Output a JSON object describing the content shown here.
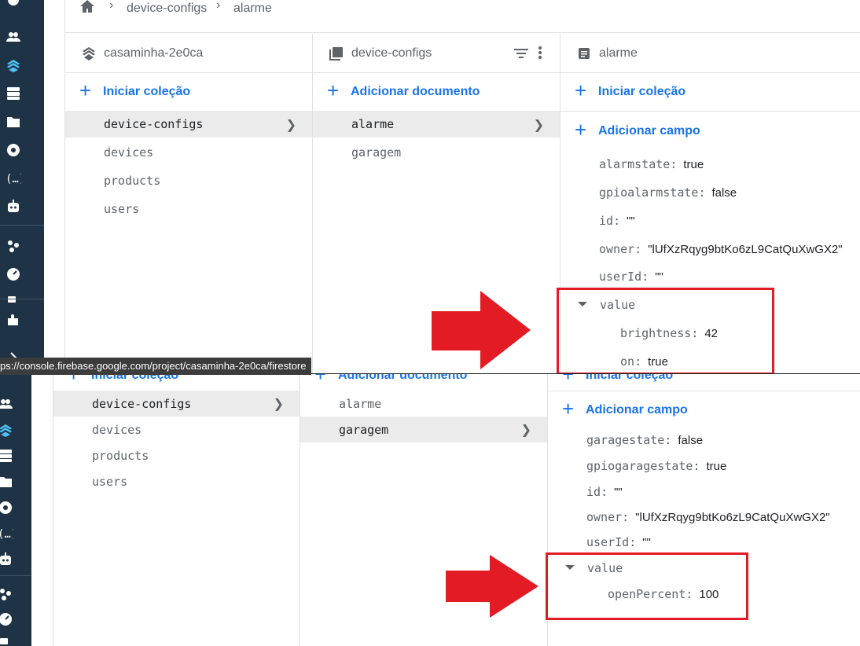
{
  "breadcrumb": {
    "home_icon": "home-icon",
    "items": [
      "device-configs",
      "alarme"
    ]
  },
  "status_url": "ps://console.firebase.google.com/project/casaminha-2e0ca/firestore",
  "colors": {
    "rail": "#1f3347",
    "accent": "#1a73e8",
    "highlight_box": "#e21b24"
  },
  "top": {
    "root": {
      "title": "casaminha-2e0ca",
      "action": "Iniciar coleção",
      "collections": [
        "device-configs",
        "devices",
        "products",
        "users"
      ],
      "selected": "device-configs"
    },
    "collection": {
      "title": "device-configs",
      "action": "Adicionar documento",
      "docs": [
        "alarme",
        "garagem"
      ],
      "selected": "alarme"
    },
    "document": {
      "title": "alarme",
      "action_collection": "Iniciar coleção",
      "action_field": "Adicionar campo",
      "fields": [
        {
          "key": "alarmstate",
          "value": "true"
        },
        {
          "key": "gpioalarmstate",
          "value": "false"
        },
        {
          "key": "id",
          "value": "\"\""
        },
        {
          "key": "owner",
          "value": "\"lUfXzRqyg9btKo6zL9CatQuXwGX2\""
        },
        {
          "key": "userId",
          "value": "\"\""
        }
      ],
      "map": {
        "key": "value",
        "children": [
          {
            "key": "brightness",
            "value": "42"
          },
          {
            "key": "on",
            "value": "true"
          }
        ]
      }
    }
  },
  "bottom": {
    "root": {
      "action": "Iniciar coleção",
      "collections": [
        "device-configs",
        "devices",
        "products",
        "users"
      ],
      "selected": "device-configs"
    },
    "collection": {
      "action": "Adicionar documento",
      "docs": [
        "alarme",
        "garagem"
      ],
      "selected": "garagem"
    },
    "document": {
      "action_collection": "Iniciar coleção",
      "action_field": "Adicionar campo",
      "fields": [
        {
          "key": "garagestate",
          "value": "false"
        },
        {
          "key": "gpiogaragestate",
          "value": "true"
        },
        {
          "key": "id",
          "value": "\"\""
        },
        {
          "key": "owner",
          "value": "\"lUfXzRqyg9btKo6zL9CatQuXwGX2\""
        },
        {
          "key": "userId",
          "value": "\"\""
        }
      ],
      "map": {
        "key": "value",
        "children": [
          {
            "key": "openPercent",
            "value": "100"
          }
        ]
      }
    }
  }
}
